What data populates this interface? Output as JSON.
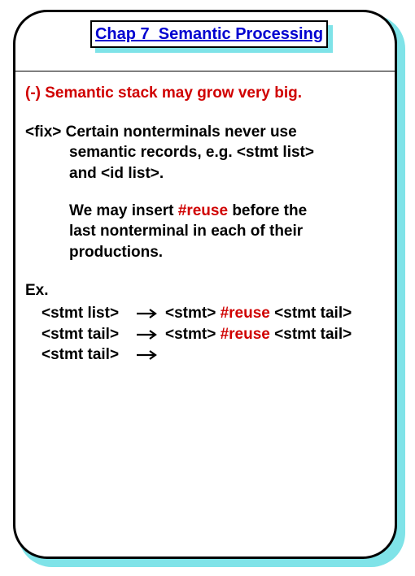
{
  "title": "Chap 7  Semantic Processing",
  "minus": "(-) Semantic stack may grow very big.",
  "fix": {
    "l1": "<fix> Certain nonterminals never use",
    "l2": "semantic records, e.g. <stmt list>",
    "l3": "and <id list>."
  },
  "para2": {
    "l1a": "We may insert  ",
    "reuse": "#reuse",
    "l1b": " before the",
    "l2": "last nonterminal in each of their",
    "l3": "productions."
  },
  "ex": "Ex.",
  "prods": [
    {
      "lhs": "<stmt list>",
      "rhs_a": "<stmt>  ",
      "rhs_reuse": "#reuse",
      "rhs_b": " <stmt tail>"
    },
    {
      "lhs": "<stmt tail>",
      "rhs_a": "<stmt>  ",
      "rhs_reuse": "#reuse",
      "rhs_b": " <stmt tail>"
    },
    {
      "lhs": "<stmt tail>",
      "rhs_a": "",
      "rhs_reuse": "",
      "rhs_b": ""
    }
  ]
}
